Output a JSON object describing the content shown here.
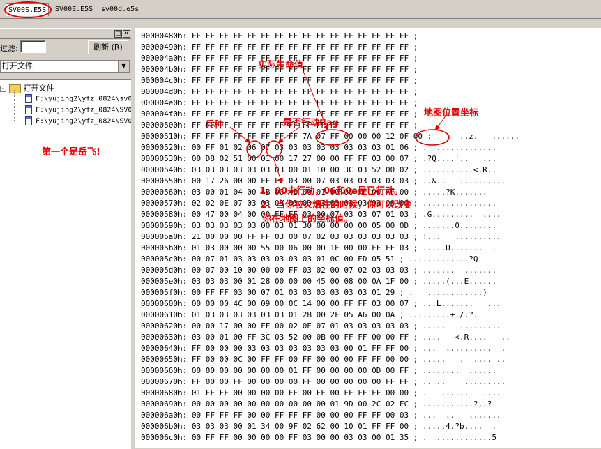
{
  "tabs": [
    {
      "label": "SV00S.E5S",
      "active": true
    },
    {
      "label": "SV00E.E5S",
      "active": false
    },
    {
      "label": "sv00d.e5s",
      "active": false
    }
  ],
  "left_panel": {
    "filter_label": "过滤:",
    "filter_value": "",
    "refresh_label": "刷新 (R)",
    "dropdown_value": "打开文件",
    "tree": {
      "root_label": "打开文件",
      "files": [
        "F:\\yujing2\\yfz_0824\\sv0",
        "F:\\yujing2\\yfz_0824\\SV0",
        "F:\\yujing2\\yfz_0824\\SV0"
      ]
    }
  },
  "hex_rows": [
    "00000480h: FF FF FF FF FF FF FF FF FF FF FF FF FF FF FF FF ;",
    "00000490h: FF FF FF FF FF FF FF FF FF FF FF FF FF FF FF FF ;",
    "000004a0h: FF FF FF FF FF FF FF FF FF FF FF FF FF FF FF FF ;",
    "000004b0h: FF FF FF FF FF FF FF FF FF FF FF FF FF FF FF FF ;",
    "000004c0h: FF FF FF FF FF FF FF FF FF FF FF FF FF FF FF FF ;",
    "000004d0h: FF FF FF FF FF FF FF FF FF FF FF FF FF FF FF FF ;",
    "000004e0h: FF FF FF FF FF FF FF FF FF FF FF FF FF FF FF FF ;",
    "000004f0h: FF FF FF FF FF FF FF FF FF FF FF FF FF FF FF FF ;",
    "00000500h: FF FF FF FF FF FF FF FF FF FF FF FF FF FF FF FF ;",
    "00000510h: FF FF FF FF FF FF FF FF 7A 07 FF 00 00 00 12 0F 00 ;      ..z.   ......",
    "00000520h: 00 FF 01 02 06 07 03 03 03 03 03 03 03 03 01 06 ; .  .............",
    "00000530h: 00 D8 02 51 00 01 00 17 27 00 00 FF FF 03 00 07 ; .?Q....'..   ...",
    "00000540h: 03 03 03 03 03 03 03 00 01 10 00 3C 03 52 00 02 ; ...........<.R..",
    "00000550h: 00 17 26 00 00 FF FF 03 00 07 03 03 03 03 03 03 ; ..&..   ..........",
    "00000560h: 03 00 01 04 00 4B 00 4B 00 01 00 00 FF 00 FF 00 ; .....?K.......",
    "00000570h: 02 02 0E 07 03 03 03 03 03 03 03 03 03 03 00 00 ; ................",
    "00000580h: 00 47 00 04 00 00 FF FF 03 00 07 03 03 07 01 03 ; .G.........  ....",
    "00000590h: 03 03 03 03 03 00 03 01 30 00 00 00 00 05 00 0D ; .......0........",
    "000005a0h: 21 00 00 00 FF FF 03 00 07 02 03 03 03 03 03 03 ; !...   ..........",
    "000005b0h: 01 03 00 00 00 55 00 06 00 0D 1E 00 00 FF FF 03 ; .....U.......  .",
    "000005c0h: 00 07 01 03 03 03 03 03 03 01 0C 00 ED 05 51 ; .............?Q",
    "000005d0h: 00 07 00 10 00 00 00 FF 03 02 00 07 02 03 03 03 ; .......  .......",
    "000005e0h: 03 03 03 00 01 28 00 00 00 45 00 08 00 0A 1F 00 ; .....(...E......",
    "000005f0h: 00 FF FF 03 00 07 01 03 03 03 03 03 03 01 29 ; .   ............)",
    "00000600h: 00 00 00 4C 00 09 00 0C 14 00 00 FF FF 03 00 07 ; ...L.......   ...",
    "00000610h: 01 03 03 03 03 03 03 01 2B 00 2F 05 A6 00 0A ; .........+./.?.",
    "00000620h: 00 00 17 00 00 FF 00 02 0E 07 01 03 03 03 03 03 ; .....   .........",
    "00000630h: 03 00 01 00 FF 3C 03 52 00 0B 00 FF FF 00 00 FF ; ....   <.R....   ..",
    "00000640h: FF 00 00 00 03 03 03 03 03 03 03 00 01 FF FF 00 ; ...  ..........  .",
    "00000650h: FF 00 00 0C 00 FF FF 00 FF 00 00 00 FF FF 00 00 ; .....   .  .... ..",
    "00000660h: 00 00 00 00 00 00 00 01 FF 00 00 00 00 0D 00 FF ; ........  ......",
    "00000670h: FF 00 00 FF 00 00 00 00 FF 00 00 00 00 00 FF FF ; .. ..    .........",
    "00000680h: 01 FF FF 00 00 00 00 FF 00 FF 00 FF FF FF 00 00 ; .   ......   ....",
    "00000690h: 00 00 00 00 00 00 00 00 00 00 01 9D 00 2C 02 FC ; ...........?,.?",
    "000006a0h: 00 FF FF FF 00 00 FF FF FF 00 00 00 FF FF 00 03 ; ...  ..   .......",
    "000006b0h: 03 03 03 00 01 34 00 9F 02 62 00 10 01 FF FF 00 ; .....4.?b....  .",
    "000006c0h: 00 FF FF 00 00 00 00 FF 03 00 00 03 03 00 01 35 ; .  ............5"
  ],
  "annotations": {
    "actual_hp": "实际生命值",
    "unit_type": "兵种",
    "action_flag": "是否行动flag",
    "map_coord": "地图位置坐标",
    "first_is": "第一个是岳飞!",
    "note_line1": "1、00未行动，06和0e是已行动。",
    "note_line2": "2、当你被火烟住的时候，你可以改变",
    "note_line3": "你在地图上的坐标值。"
  },
  "colors": {
    "annotation": "#e00000",
    "window_bg": "#d4d0c8"
  }
}
